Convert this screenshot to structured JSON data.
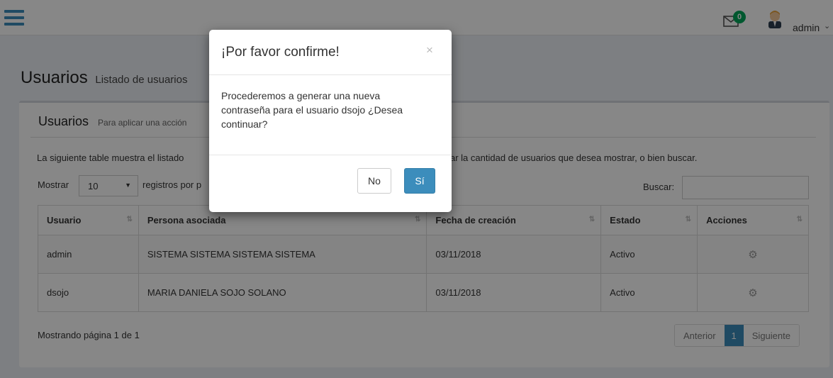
{
  "header": {
    "mail_count": "0",
    "user_name": "admin",
    "user_caret": "⌄"
  },
  "page": {
    "title": "Usuarios",
    "subtitle": "Listado de usuarios"
  },
  "box": {
    "title": "Usuarios",
    "note": "Para aplicar una acción",
    "description_left": "La siguiente table muestra el listado",
    "description_right": "ar la cantidad de usuarios que desea mostrar, o bien buscar.",
    "length_label": "Mostrar",
    "length_value": "10",
    "length_suffix": "registros por p",
    "search_label": "Buscar:",
    "search_value": ""
  },
  "table": {
    "columns": [
      "Usuario",
      "Persona asociada",
      "Fecha de creación",
      "Estado",
      "Acciones"
    ],
    "rows": [
      {
        "usuario": "admin",
        "persona": "SISTEMA SISTEMA SISTEMA SISTEMA",
        "fecha": "03/11/2018",
        "estado": "Activo"
      },
      {
        "usuario": "dsojo",
        "persona": "MARIA DANIELA SOJO SOLANO",
        "fecha": "03/11/2018",
        "estado": "Activo"
      }
    ]
  },
  "footer": {
    "page_info": "Mostrando página 1 de 1",
    "prev": "Anterior",
    "current": "1",
    "next": "Siguiente"
  },
  "modal": {
    "title": "¡Por favor confirme!",
    "close": "×",
    "body": "Procederemos a generar una nueva contraseña para el usuario dsojo ¿Desea continuar?",
    "no_label": "No",
    "yes_label": "Sí"
  },
  "colors": {
    "primary": "#3c8dbc",
    "badge": "#00a65a",
    "overlay": "rgba(0,0,0,0.47)"
  },
  "icons": [
    "menu-icon",
    "envelope-icon",
    "user-avatar-icon",
    "sort-icon",
    "gear-icon",
    "close-icon"
  ]
}
